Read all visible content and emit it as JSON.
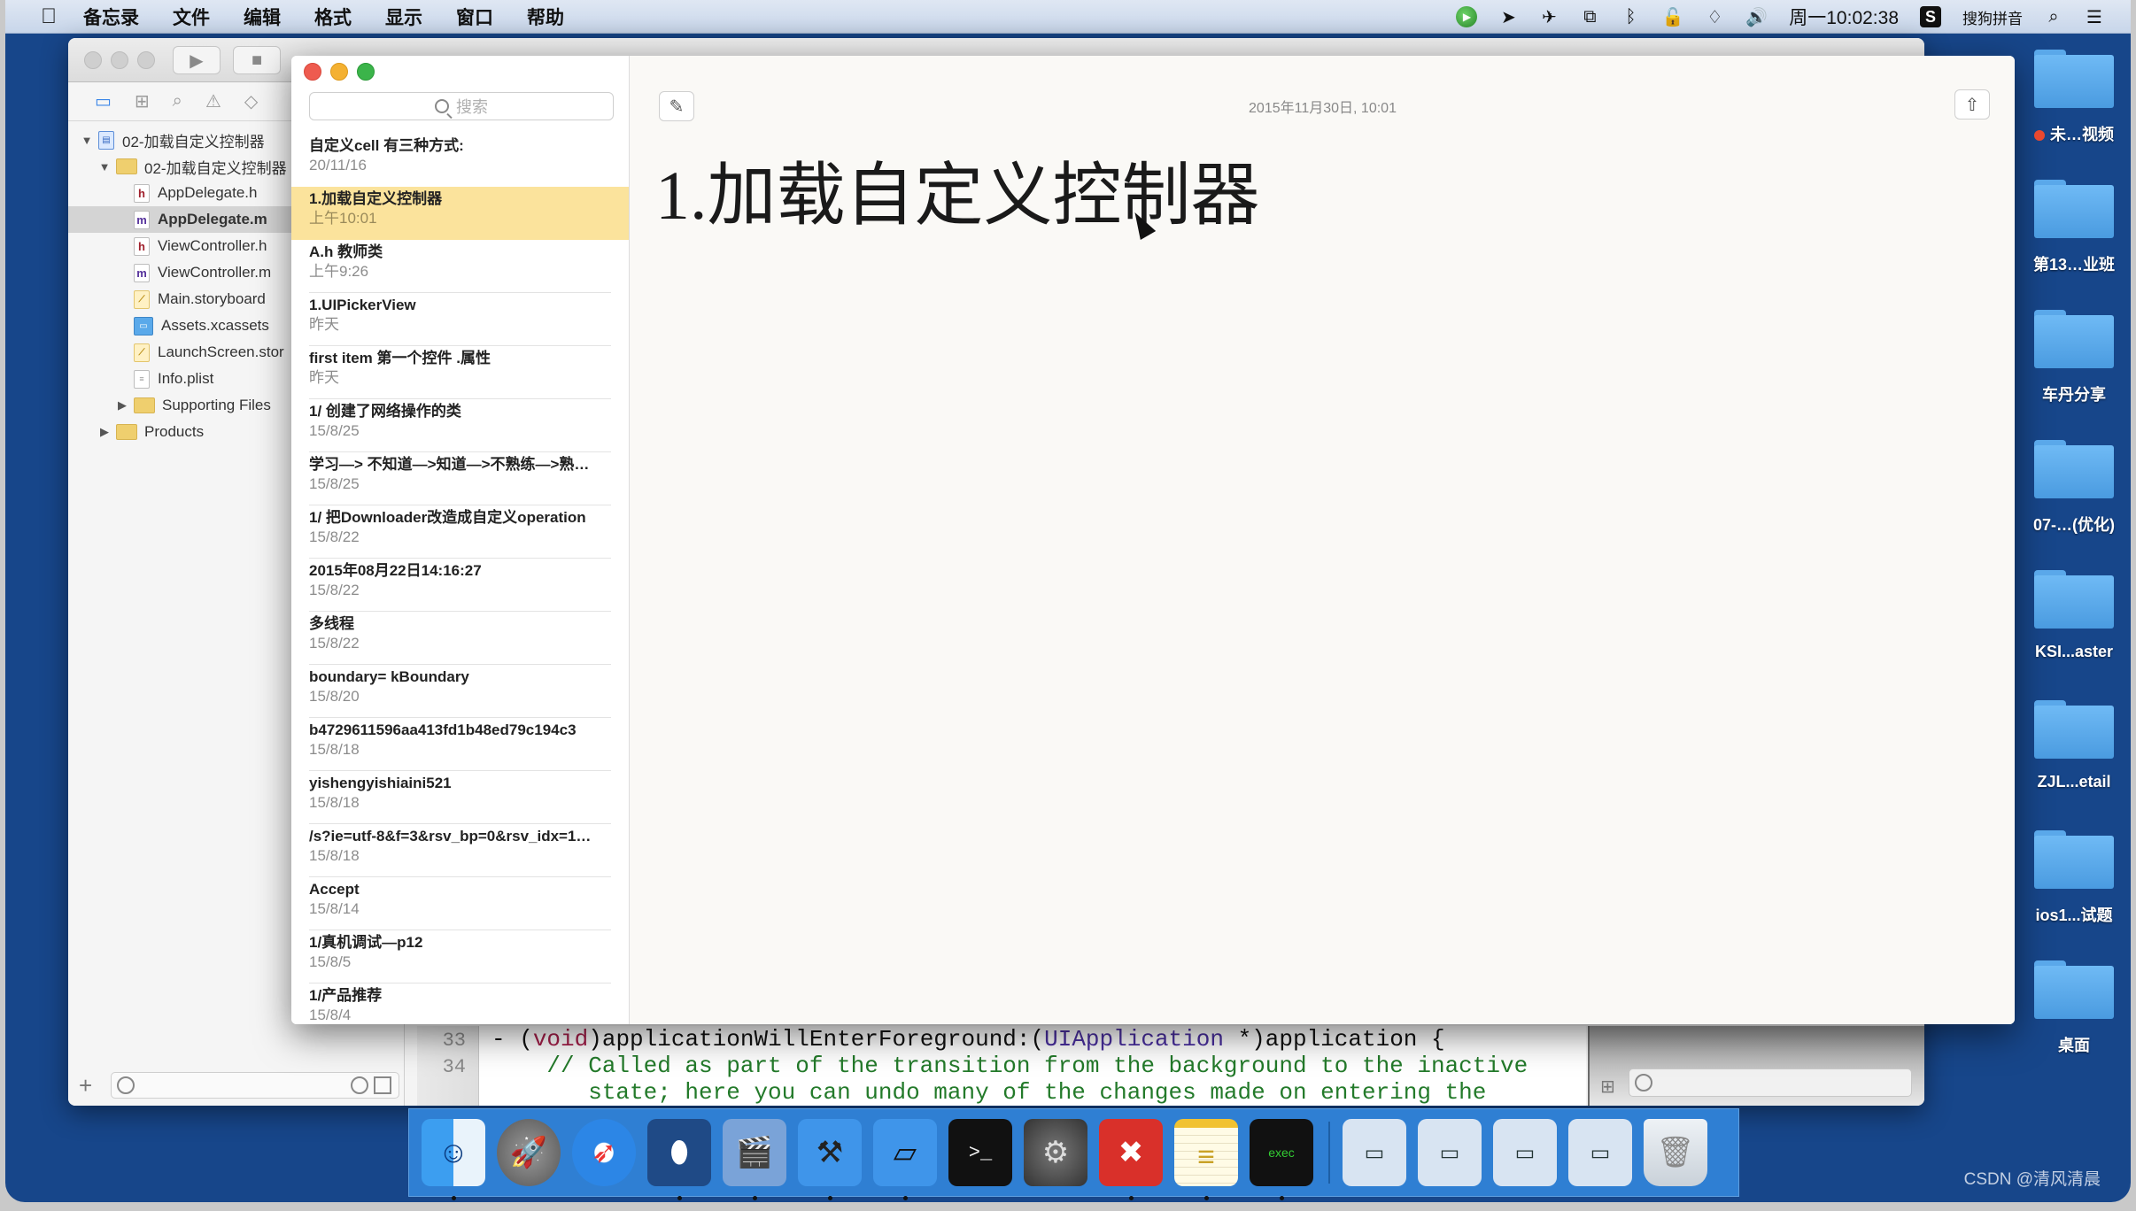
{
  "menubar": {
    "apple_icon": "apple-icon",
    "items": [
      "备忘录",
      "文件",
      "编辑",
      "格式",
      "显示",
      "窗口",
      "帮助"
    ],
    "status_icons": [
      "green-play-icon",
      "location-arrow-icon",
      "airplane-icon",
      "screen-record-icon",
      "bluetooth-like-icon",
      "lock-icon",
      "wifi-icon",
      "volume-icon"
    ],
    "clock": "周一10:02:38",
    "input_method": "搜狗拼音",
    "spotlight_icon": "search-icon",
    "notification_icon": "list-icon"
  },
  "xcode": {
    "toolbar": {
      "run_icon": "▶",
      "stop_icon": "■"
    },
    "navigator_tabs": [
      "folder-icon",
      "hierarchy-icon",
      "search-icon",
      "warning-icon",
      "test-icon"
    ],
    "tree": [
      {
        "label": "02-加载自定义控制器",
        "type": "project",
        "indent": 0,
        "disclosure": "▼"
      },
      {
        "label": "02-加载自定义控制器",
        "type": "folder",
        "indent": 1,
        "disclosure": "▼"
      },
      {
        "label": "AppDelegate.h",
        "type": "h",
        "indent": 2
      },
      {
        "label": "AppDelegate.m",
        "type": "m",
        "indent": 2,
        "selected": true
      },
      {
        "label": "ViewController.h",
        "type": "h",
        "indent": 2
      },
      {
        "label": "ViewController.m",
        "type": "m",
        "indent": 2
      },
      {
        "label": "Main.storyboard",
        "type": "storyboard",
        "indent": 2
      },
      {
        "label": "Assets.xcassets",
        "type": "assets",
        "indent": 2
      },
      {
        "label": "LaunchScreen.stor",
        "type": "storyboard",
        "indent": 2
      },
      {
        "label": "Info.plist",
        "type": "plist",
        "indent": 2
      },
      {
        "label": "Supporting Files",
        "type": "folder",
        "indent": 2,
        "disclosure": "▶"
      },
      {
        "label": "Products",
        "type": "folder",
        "indent": 1,
        "disclosure": "▶"
      }
    ],
    "footer": {
      "add_label": "+"
    },
    "code": {
      "lines": [
        {
          "number": "33",
          "prefix": "- (",
          "keyword": "void",
          "mid": ")applicationWillEnterForeground:(",
          "type": "UIApplication",
          "suffix": " *)application {"
        },
        {
          "number": "34",
          "comment": "    // Called as part of the transition from the background to the inactive"
        },
        {
          "number": "",
          "comment": "       state; here you can undo many of the changes made on entering the"
        }
      ]
    }
  },
  "notes": {
    "search_placeholder": "搜索",
    "items": [
      {
        "title": "自定义cell 有三种方式:",
        "date": "20/11/16"
      },
      {
        "title": "1.加载自定义控制器",
        "date": "上午10:01",
        "selected": true
      },
      {
        "title": "A.h  教师类",
        "date": "上午9:26"
      },
      {
        "title": "1.UIPickerView",
        "date": "昨天"
      },
      {
        "title": "first item 第一个控件 .属性",
        "date": "昨天"
      },
      {
        "title": "1/ 创建了网络操作的类",
        "date": "15/8/25"
      },
      {
        "title": "学习—> 不知道—>知道—>不熟练—>熟…",
        "date": "15/8/25"
      },
      {
        "title": "1/ 把Downloader改造成自定义operation",
        "date": "15/8/22"
      },
      {
        "title": "2015年08月22日14:16:27",
        "date": "15/8/22"
      },
      {
        "title": "多线程",
        "date": "15/8/22"
      },
      {
        "title": "boundary= kBoundary",
        "date": "15/8/20"
      },
      {
        "title": "b4729611596aa413fd1b48ed79c194c3",
        "date": "15/8/18"
      },
      {
        "title": "yishengyishiaini521",
        "date": "15/8/18"
      },
      {
        "title": "/s?ie=utf-8&f=3&rsv_bp=0&rsv_idx=1…",
        "date": "15/8/18"
      },
      {
        "title": "Accept",
        "date": "15/8/14"
      },
      {
        "title": "1/真机调试—p12",
        "date": "15/8/5"
      },
      {
        "title": "1/产品推荐",
        "date": "15/8/4"
      }
    ],
    "editor": {
      "timestamp": "2015年11月30日, 10:01",
      "heading": "1.加载自定义控制器",
      "compose_icon": "✎",
      "share_icon": "⇧"
    }
  },
  "desktop": {
    "folders": [
      {
        "label": "未…视频",
        "tag": "red"
      },
      {
        "label": "第13…业班"
      },
      {
        "label": "车丹分享"
      },
      {
        "label": "07-…(优化)"
      },
      {
        "label": "KSI...aster"
      },
      {
        "label": "ZJL...etail"
      },
      {
        "label": "ios1...试题"
      },
      {
        "label": "桌面"
      }
    ]
  },
  "dock": {
    "apps": [
      {
        "name": "finder",
        "glyph": "☺",
        "running": true
      },
      {
        "name": "launchpad",
        "glyph": "🚀",
        "running": false
      },
      {
        "name": "safari",
        "glyph": "➶",
        "running": false
      },
      {
        "name": "mouse-app",
        "glyph": "⬮",
        "running": true
      },
      {
        "name": "video-app",
        "glyph": "🎬",
        "running": true
      },
      {
        "name": "xcode",
        "glyph": "⚒",
        "running": true
      },
      {
        "name": "instruments",
        "glyph": "▱",
        "running": true
      },
      {
        "name": "terminal",
        "glyph": ">_",
        "running": false
      },
      {
        "name": "system-preferences",
        "glyph": "⚙",
        "running": false
      },
      {
        "name": "xmind",
        "glyph": "✖",
        "running": true
      },
      {
        "name": "notes",
        "glyph": "≡",
        "running": true
      },
      {
        "name": "console",
        "glyph": "exec",
        "running": true
      }
    ],
    "minimized": [
      {
        "name": "minimized-window-1",
        "glyph": "▭"
      },
      {
        "name": "minimized-window-2",
        "glyph": "▭"
      },
      {
        "name": "minimized-window-3",
        "glyph": "▭"
      },
      {
        "name": "minimized-window-4",
        "glyph": "▭"
      },
      {
        "name": "trash",
        "glyph": "🗑"
      }
    ]
  },
  "watermark": "CSDN @清风清晨"
}
